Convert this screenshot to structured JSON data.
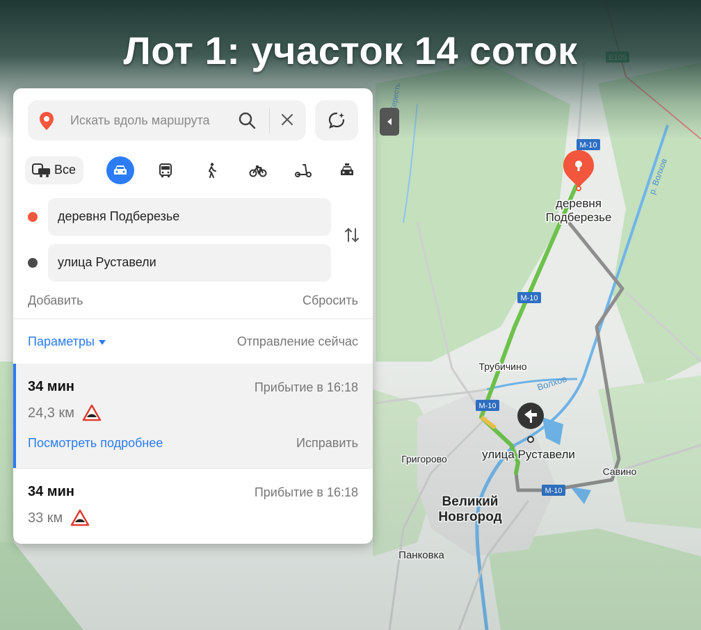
{
  "banner": {
    "title": "Лот 1: участок 14 соток"
  },
  "panel": {
    "search_placeholder": "Искать вдоль маршрута",
    "modes": {
      "all_label": "Все",
      "items": [
        "all-transport",
        "car",
        "bus",
        "walk",
        "bicycle",
        "scooter",
        "taxi"
      ],
      "active": "car"
    },
    "from": {
      "value": "деревня Подберезье",
      "dot_color": "#f2563c"
    },
    "to": {
      "value": "улица Руставели",
      "dot_color": "#4a4a4a"
    },
    "add_label": "Добавить",
    "reset_label": "Сбросить",
    "params_label": "Параметры",
    "departure_label": "Отправление сейчас",
    "routes": [
      {
        "time": "34 мин",
        "arrival": "Прибытие в 16:18",
        "distance": "24,3 км",
        "more": "Посмотреть подробнее",
        "fix": "Исправить",
        "selected": true
      },
      {
        "time": "34 мин",
        "arrival": "Прибытие в 16:18",
        "distance": "33 км",
        "selected": false
      }
    ]
  },
  "map": {
    "places": {
      "origin": "деревня Подберезье",
      "destination": "улица Руставели",
      "trubichino": "Трубичино",
      "grigorovo": "Григорово",
      "savino": "Савино",
      "city": "Великий Новгород",
      "pankovka": "Панковка",
      "river_volkhov": "Волхов",
      "river_malyi_volkhov": "р. Волхов",
      "river_keresti": "Кересть"
    },
    "road_shields": {
      "e105": "E105",
      "m10": "M-10"
    },
    "colors": {
      "route_main": "#6cc24a",
      "route_alt": "#8e8e8e",
      "pin_red": "#f2563c",
      "accent_blue": "#2b7cf6",
      "water": "#6fb4ea",
      "forest": "#b9d9b4",
      "shield": "#2e6fc4"
    }
  }
}
